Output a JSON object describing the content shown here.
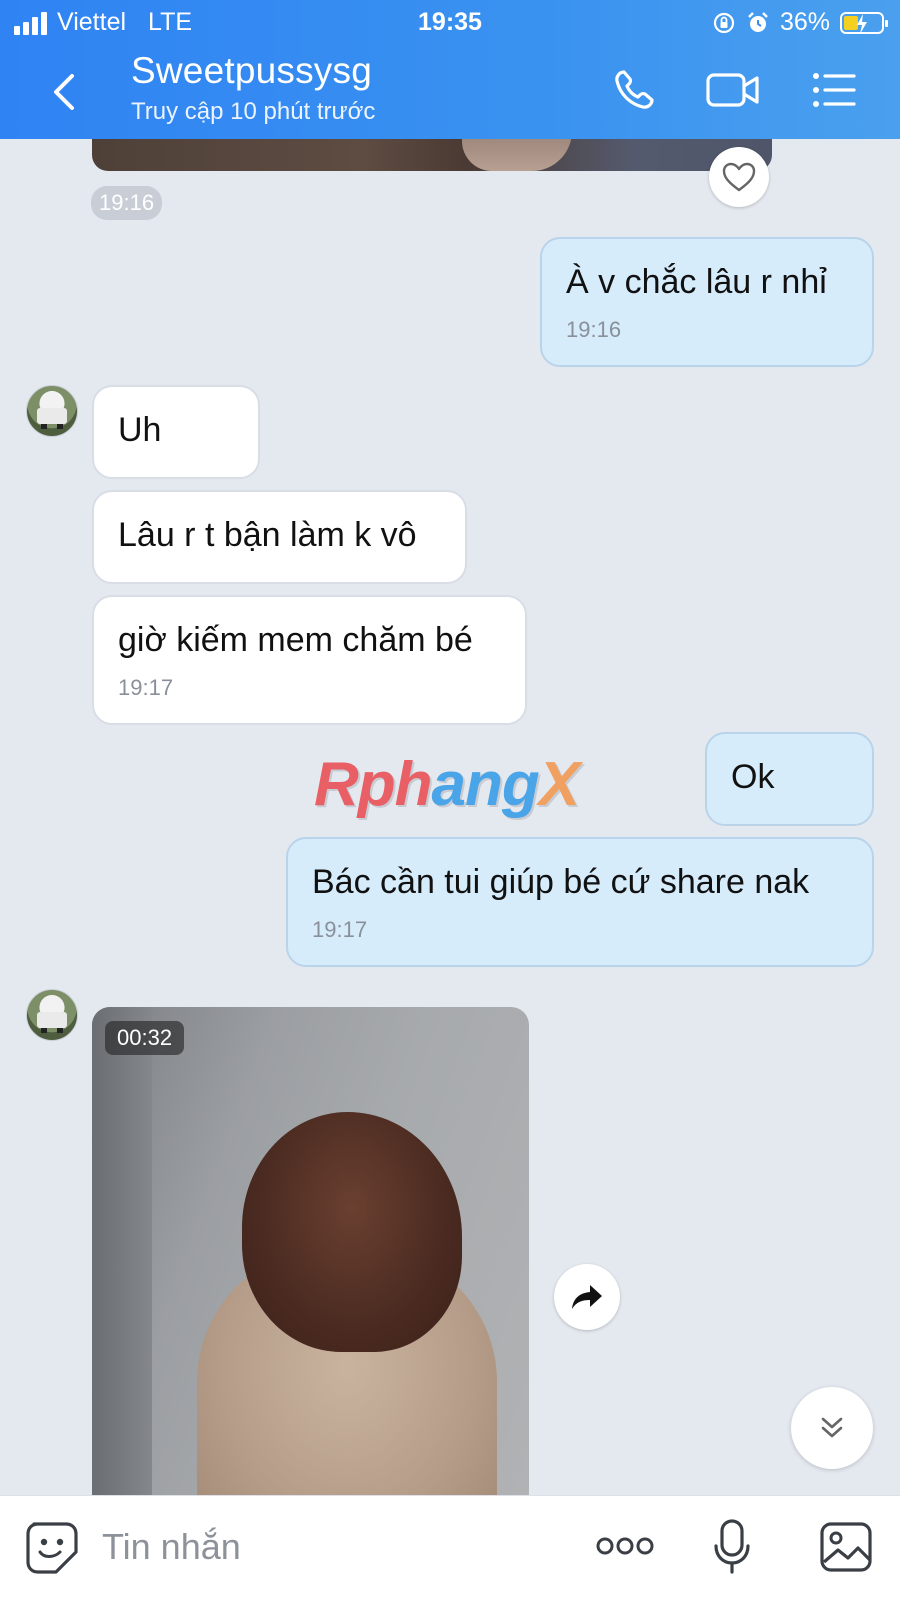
{
  "status_bar": {
    "carrier": "Viettel",
    "network": "LTE",
    "time": "19:35",
    "battery": "36%"
  },
  "header": {
    "contact_name": "Sweetpussysg",
    "contact_status": "Truy cập 10 phút trước"
  },
  "messages": {
    "top_time": "19:16",
    "m1": {
      "text": "À v chắc lâu r nhỉ",
      "time": "19:16"
    },
    "m2": {
      "text": "Uh"
    },
    "m3": {
      "text": "Lâu r t bận làm k vô"
    },
    "m4": {
      "text": "giờ kiếm mem chăm bé",
      "time": "19:17"
    },
    "m5": {
      "text": "Ok"
    },
    "m6": {
      "text": "Bác cần tui giúp bé cứ share nak",
      "time": "19:17"
    },
    "video_duration": "00:32"
  },
  "watermark": {
    "part1": "Rph",
    "part2": "ang",
    "part3": "X"
  },
  "input": {
    "placeholder": "Tin nhắn"
  },
  "icons": {
    "back": "chevron-left-icon",
    "call": "phone-icon",
    "video_call": "video-camera-icon",
    "menu": "list-menu-icon",
    "heart": "heart-icon",
    "share": "forward-arrow-icon",
    "scroll_down": "double-chevron-down-icon",
    "sticker": "sticker-face-icon",
    "more": "more-dots-icon",
    "mic": "microphone-icon",
    "image": "image-icon"
  },
  "colors": {
    "header": "#2f83f3",
    "outgoing_bubble": "#d6ecfb",
    "incoming_bubble": "#ffffff",
    "background": "#e4e8ef"
  }
}
